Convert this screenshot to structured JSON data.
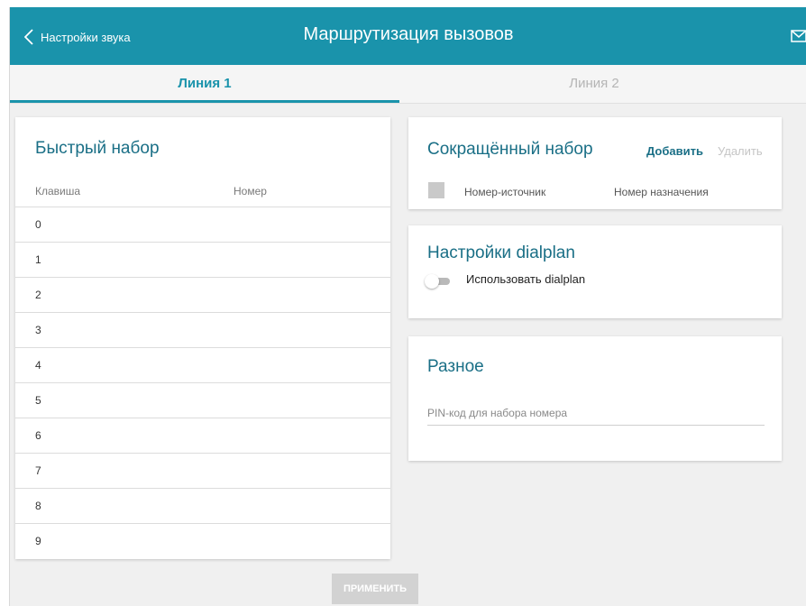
{
  "header": {
    "back_label": "Настройки звука",
    "title": "Маршрутизация вызовов",
    "background": "#1a93ab",
    "icons": [
      "chevron-left-icon",
      "mail-icon"
    ]
  },
  "tabs": [
    {
      "label": "Линия 1",
      "active": true
    },
    {
      "label": "Линия 2",
      "active": false
    }
  ],
  "speed_dial": {
    "title": "Быстрый набор",
    "columns": [
      "Клавиша",
      "Номер"
    ],
    "rows": [
      {
        "key": "0",
        "number": ""
      },
      {
        "key": "1",
        "number": ""
      },
      {
        "key": "2",
        "number": ""
      },
      {
        "key": "3",
        "number": ""
      },
      {
        "key": "4",
        "number": ""
      },
      {
        "key": "5",
        "number": ""
      },
      {
        "key": "6",
        "number": ""
      },
      {
        "key": "7",
        "number": ""
      },
      {
        "key": "8",
        "number": ""
      },
      {
        "key": "9",
        "number": ""
      }
    ]
  },
  "abbreviated": {
    "title": "Сокращённый набор",
    "add_label": "Добавить",
    "delete_label": "Удалить",
    "columns": [
      "Номер-источник",
      "Номер назначения"
    ]
  },
  "dialplan": {
    "title": "Настройки dialplan",
    "toggle_label": "Использовать dialplan",
    "enabled": false
  },
  "misc": {
    "title": "Разное",
    "pin_placeholder": "PIN-код для набора номера",
    "pin_value": ""
  },
  "apply_label": "ПРИМЕНИТЬ"
}
